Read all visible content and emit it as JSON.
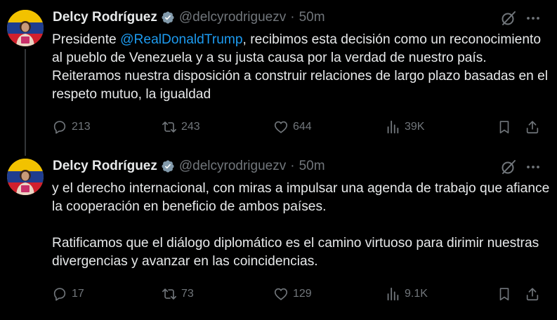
{
  "tweets": [
    {
      "author_name": "Delcy Rodríguez",
      "handle": "@delcyrodriguezv",
      "separator": "·",
      "time": "50m",
      "text_before_mention": "Presidente ",
      "mention": "@RealDonaldTrump",
      "text_after_mention": ", recibimos esta decisión como un reconocimiento al pueblo de Venezuela y a su justa causa por la verdad de nuestro país. Reiteramos nuestra disposición a construir relaciones de largo plazo basadas en el respeto mutuo, la igualdad",
      "stats": {
        "replies": "213",
        "reposts": "243",
        "likes": "644",
        "views": "39K"
      }
    },
    {
      "author_name": "Delcy Rodríguez",
      "handle": "@delcyrodriguezv",
      "separator": "·",
      "time": "50m",
      "paragraph_1": "y el derecho internacional, con miras a impulsar una agenda de trabajo que afiance la cooperación en beneficio de ambos países.",
      "paragraph_2": "Ratificamos que el diálogo diplomático es el camino virtuoso para dirimir nuestras divergencias y avanzar en las coincidencias.",
      "stats": {
        "replies": "17",
        "reposts": "73",
        "likes": "129",
        "views": "9.1K"
      }
    }
  ],
  "icons": {
    "verified": "verified-badge-icon",
    "grok": "grok-icon",
    "more": "more-icon",
    "reply": "reply-icon",
    "repost": "repost-icon",
    "like": "heart-icon",
    "views": "views-icon",
    "bookmark": "bookmark-icon",
    "share": "share-icon"
  },
  "colors": {
    "background": "#000000",
    "text_primary": "#e7e9ea",
    "text_secondary": "#71767b",
    "link": "#1d9bf0",
    "verified_badge": "#829aab",
    "thread_line": "#333639"
  }
}
